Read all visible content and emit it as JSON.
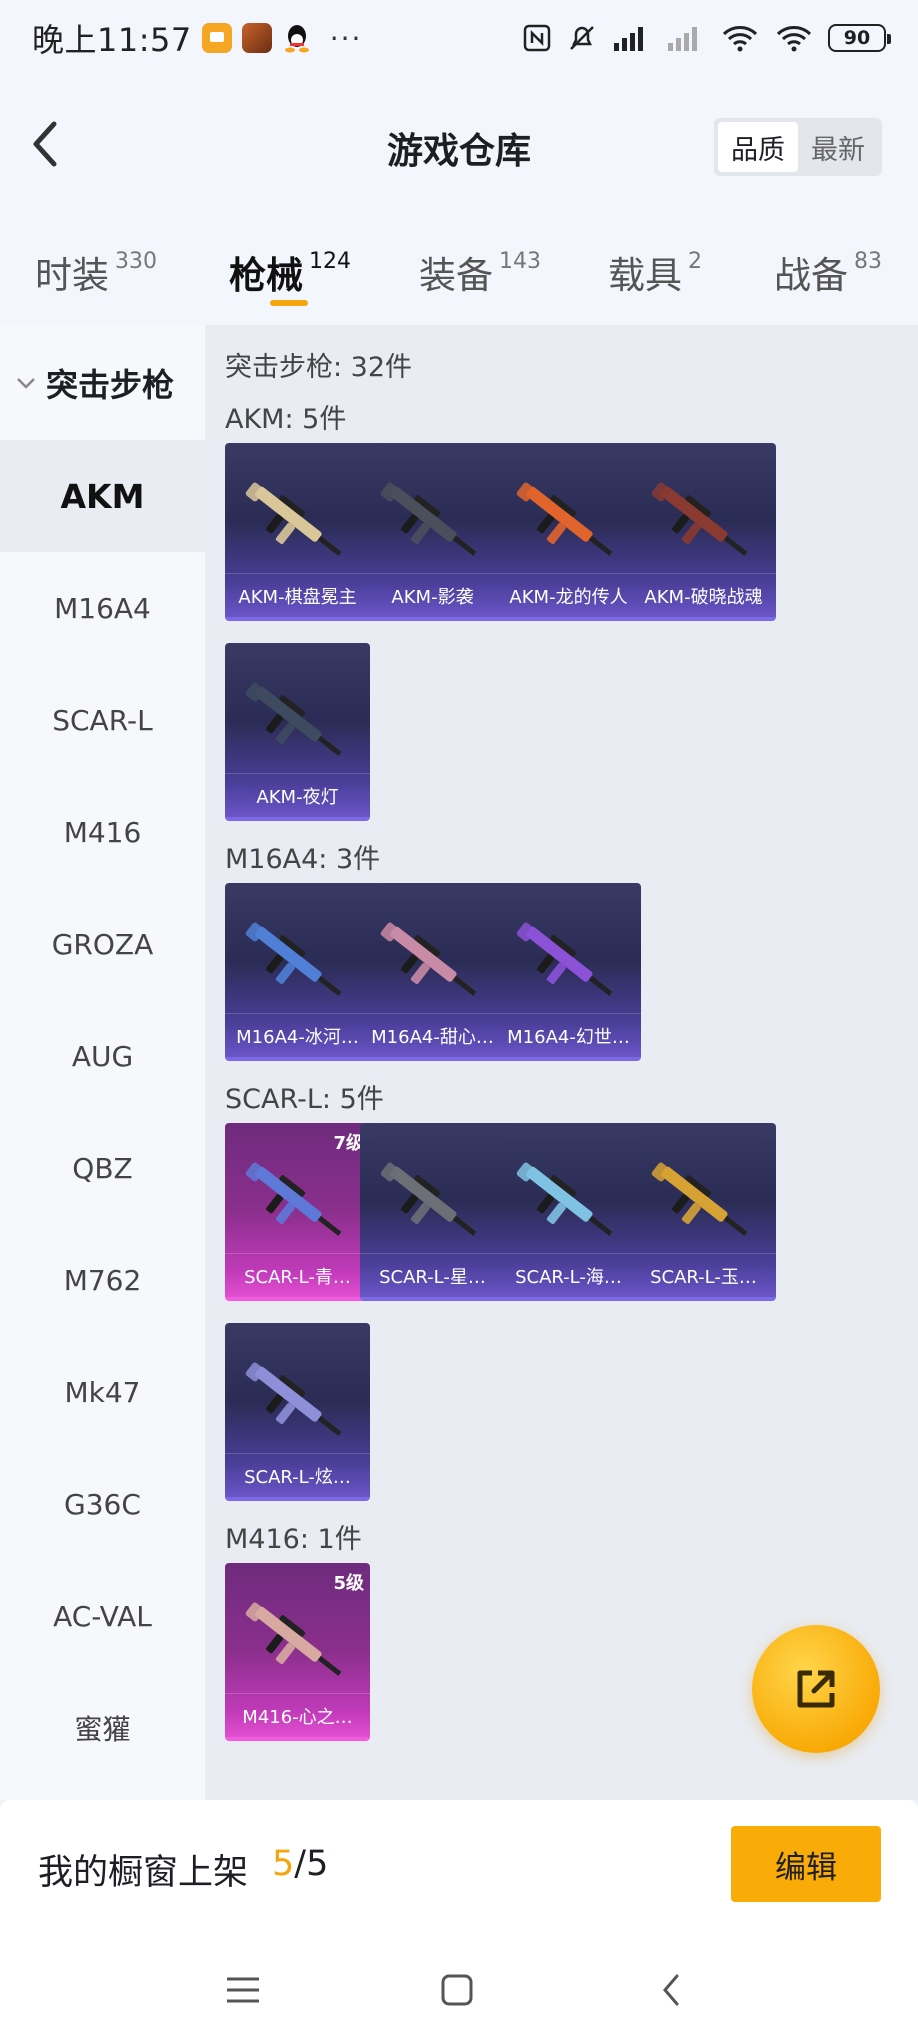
{
  "status_bar": {
    "time": "晚上11:57",
    "battery": "90"
  },
  "header": {
    "title": "游戏仓库",
    "sort_options": [
      "品质",
      "最新"
    ],
    "sort_active": "品质"
  },
  "tabs": [
    {
      "label": "时装",
      "count": "330"
    },
    {
      "label": "枪械",
      "count": "124",
      "active": true
    },
    {
      "label": "装备",
      "count": "143"
    },
    {
      "label": "载具",
      "count": "2"
    },
    {
      "label": "战备",
      "count": "83"
    }
  ],
  "sidebar": {
    "group": "突击步枪",
    "items": [
      "AKM",
      "M16A4",
      "SCAR-L",
      "M416",
      "GROZA",
      "AUG",
      "QBZ",
      "M762",
      "Mk47",
      "G36C",
      "AC-VAL",
      "蜜獾"
    ],
    "active": "AKM"
  },
  "content": {
    "summary": "突击步枪: 32件",
    "sections": [
      {
        "heading": "AKM: 5件",
        "items": [
          {
            "name": "AKM-棋盘冕主",
            "rarity": "purple",
            "gun_color": "#d9c79a"
          },
          {
            "name": "AKM-影袭",
            "rarity": "purple",
            "gun_color": "#4a4f5c"
          },
          {
            "name": "AKM-龙的传人",
            "rarity": "purple",
            "gun_color": "#e0642c"
          },
          {
            "name": "AKM-破晓战魂",
            "rarity": "purple",
            "gun_color": "#8a3a30"
          },
          {
            "name": "AKM-夜灯",
            "rarity": "purple",
            "gun_color": "#3d4a60"
          }
        ]
      },
      {
        "heading": "M16A4: 3件",
        "items": [
          {
            "name": "M16A4-冰河…",
            "rarity": "purple",
            "gun_color": "#4f7fd6"
          },
          {
            "name": "M16A4-甜心…",
            "rarity": "purple",
            "gun_color": "#c98aa5"
          },
          {
            "name": "M16A4-幻世…",
            "rarity": "purple",
            "gun_color": "#8b52d8"
          }
        ]
      },
      {
        "heading": "SCAR-L: 5件",
        "items": [
          {
            "name": "SCAR-L-青…",
            "rarity": "pink",
            "level": "7级",
            "gun_color": "#5e79d8"
          },
          {
            "name": "SCAR-L-星…",
            "rarity": "purple",
            "gun_color": "#6c6f76"
          },
          {
            "name": "SCAR-L-海…",
            "rarity": "purple",
            "gun_color": "#7fc2e3"
          },
          {
            "name": "SCAR-L-玉…",
            "rarity": "purple",
            "gun_color": "#d6a233"
          },
          {
            "name": "SCAR-L-炫…",
            "rarity": "purple",
            "gun_color": "#8d8fd9"
          }
        ]
      },
      {
        "heading": "M416: 1件",
        "items": [
          {
            "name": "M416-心之…",
            "rarity": "pink",
            "level": "5级",
            "gun_color": "#d8a9a0"
          }
        ]
      }
    ]
  },
  "bottom_bar": {
    "label": "我的橱窗上架",
    "count_current": "5",
    "count_total": "/5",
    "edit_label": "编辑"
  },
  "colors": {
    "accent": "#f9ab08",
    "card_purple": "#2b2c55",
    "card_pink": "#b03ab0"
  }
}
